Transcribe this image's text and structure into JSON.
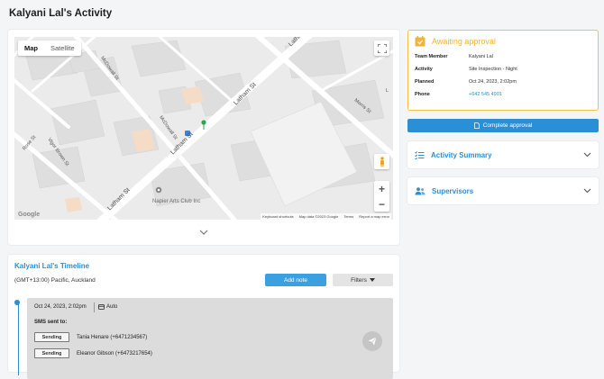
{
  "page": {
    "title": "Kalyani Lal's Activity"
  },
  "map": {
    "toggle": {
      "map_label": "Map",
      "satellite_label": "Satellite",
      "active": "Map"
    },
    "streets": {
      "latham_1": "Latham St",
      "latham_2": "Latham St",
      "latham_3": "Latham St",
      "latham_top": "Latha",
      "mcdowall_1": "McDowall St",
      "mcdowall_2": "McDowall St",
      "vigor_brown": "Vigor Brown St",
      "rose": "Rose St",
      "morris": "Morris St",
      "l_st": "L"
    },
    "poi": "Napier Arts Club Inc",
    "google_logo": "Google",
    "footer": {
      "shortcuts": "Keyboard shortcuts",
      "data": "Map data ©2023 Google",
      "terms": "Terms",
      "report": "Report a map error"
    }
  },
  "approval": {
    "title": "Awaiting approval",
    "accent_color": "#f0b43a",
    "fields": [
      {
        "key": "Team Member",
        "value": "Kalyani Lal"
      },
      {
        "key": "Activity",
        "value": "Site Inspection - Night"
      },
      {
        "key": "Planned",
        "value": "Oct 24, 2023, 2:02pm"
      },
      {
        "key": "Phone",
        "value": "+642 545 4901"
      }
    ],
    "complete_label": "Complete approval"
  },
  "accordions": {
    "activity_summary": "Activity Summary",
    "supervisors": "Supervisors"
  },
  "timeline": {
    "title": "Kalyani Lal's Timeline",
    "timezone": "(GMT+13:00) Pacific, Auckland",
    "add_note_label": "Add note",
    "filters_label": "Filters",
    "entry": {
      "date": "Oct 24, 2023, 2:02pm",
      "mode": "Auto",
      "sms_label": "SMS sent to:",
      "recipients": [
        {
          "status": "Sending",
          "name": "Tania Henare (+6471234567)"
        },
        {
          "status": "Sending",
          "name": "Eleanor Gibson (+6473217654)"
        }
      ]
    }
  },
  "colors": {
    "primary": "#2b8fd8",
    "warning": "#f2c24b"
  }
}
